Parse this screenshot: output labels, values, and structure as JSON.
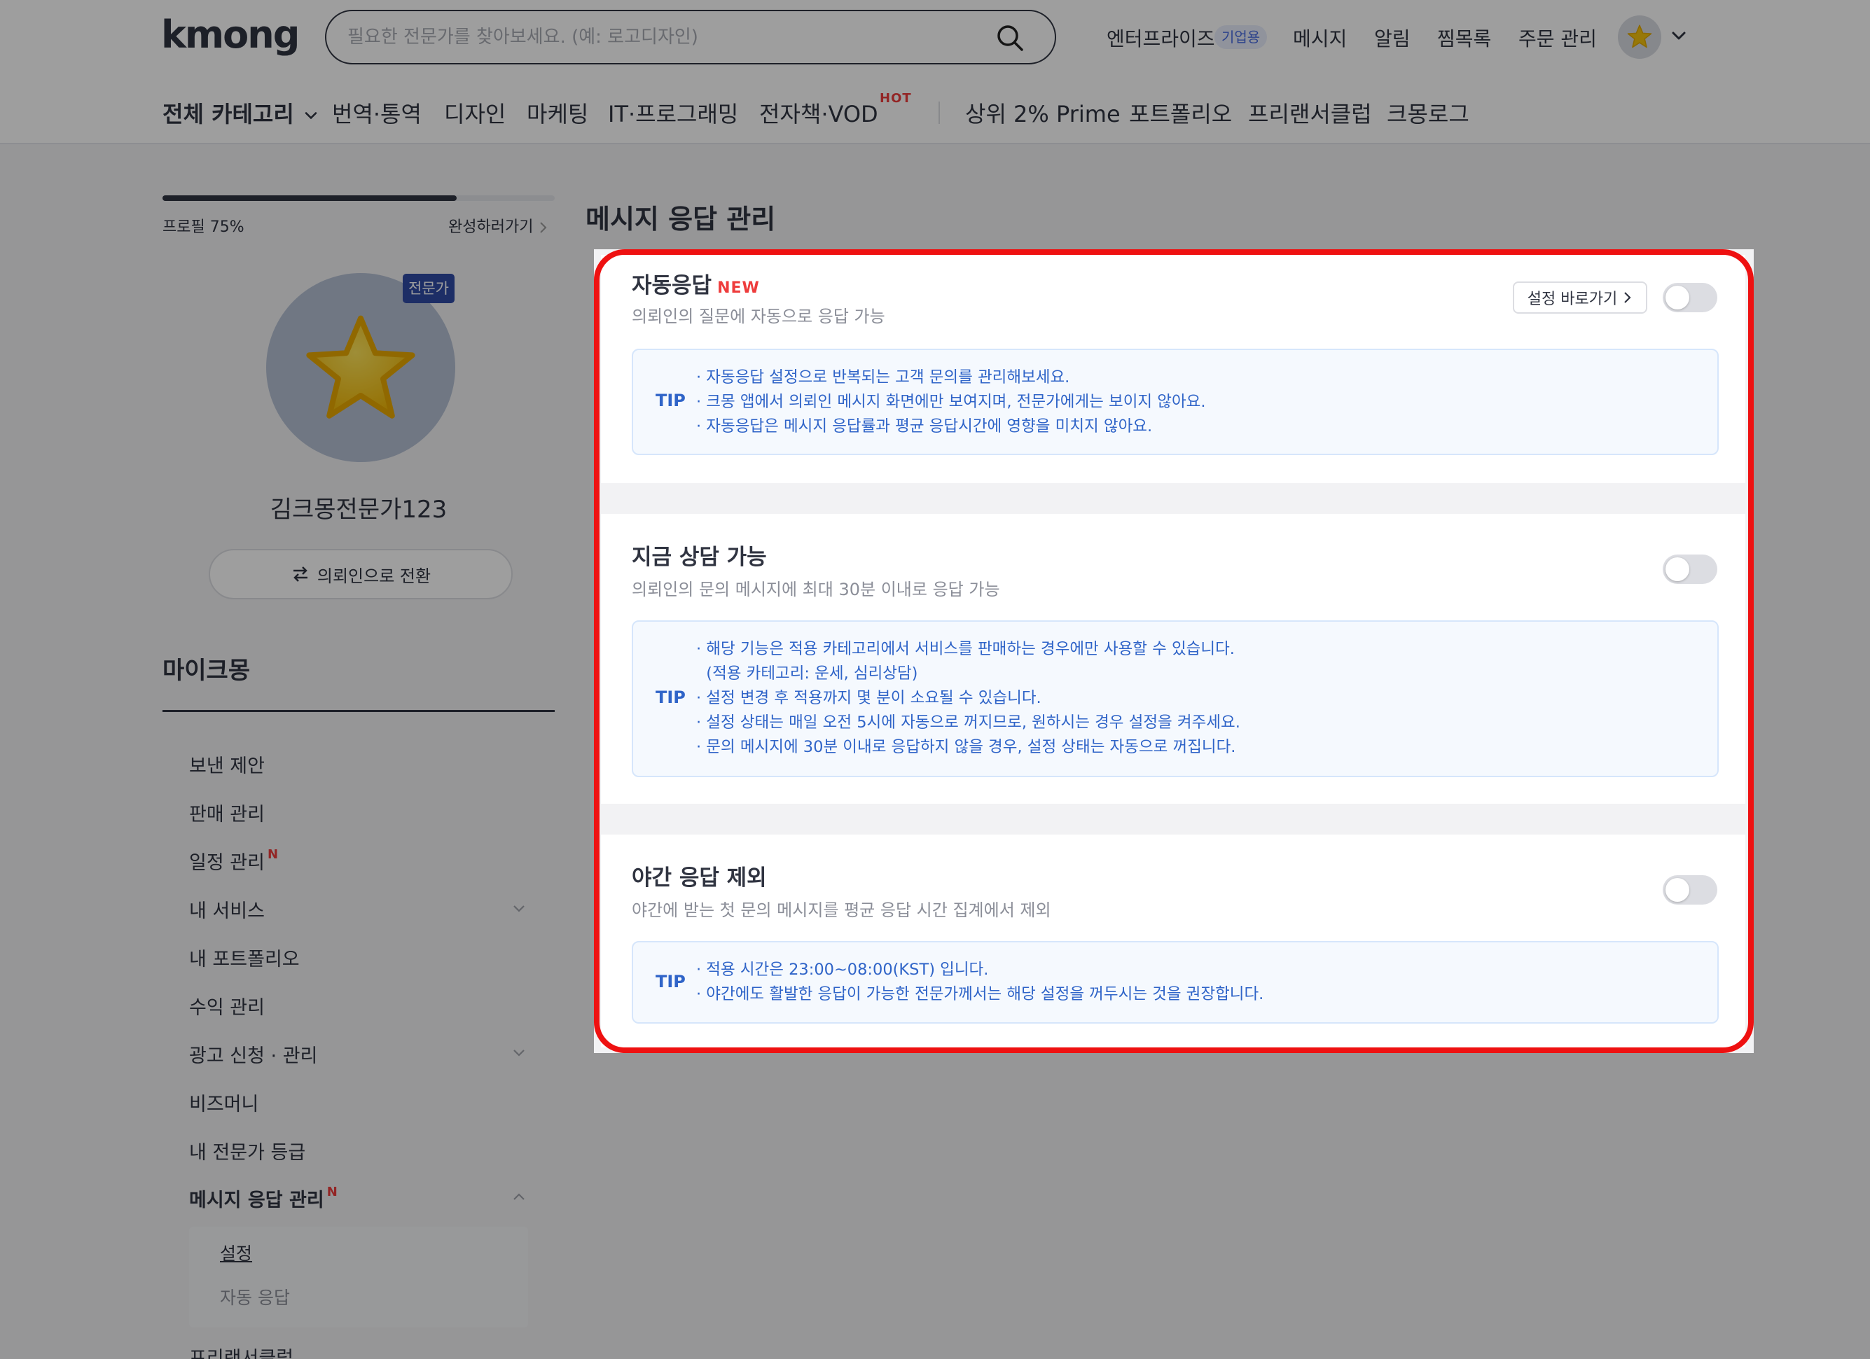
{
  "header": {
    "logo": "kmong",
    "search_placeholder": "필요한 전문가를 찾아보세요. (예: 로고디자인)",
    "menu": {
      "enterprise": "엔터프라이즈",
      "enterprise_badge": "기업용",
      "message": "메시지",
      "alarm": "알림",
      "wishlist": "찜목록",
      "orders": "주문 관리"
    },
    "categories": {
      "all": "전체 카테고리",
      "translation": "번역·통역",
      "design": "디자인",
      "marketing": "마케팅",
      "it": "IT·프로그래밍",
      "ebook": "전자책·VOD",
      "hot": "HOT",
      "prime": "상위 2% Prime",
      "portfolio": "포트폴리오",
      "club": "프리랜서클럽",
      "log": "크몽로그"
    }
  },
  "sidebar": {
    "profile_progress": 0.75,
    "profile_label": "프로필 75%",
    "complete_label": "완성하러가기",
    "expert_badge": "전문가",
    "username": "김크몽전문가123",
    "switch_label": "의뢰인으로 전환",
    "my_title": "마이크몽",
    "items": {
      "sent": "보낸 제안",
      "sales": "판매 관리",
      "schedule": "일정 관리",
      "services": "내 서비스",
      "portfolio": "내 포트폴리오",
      "revenue": "수익 관리",
      "ads": "광고 신청 · 관리",
      "bizmoney": "비즈머니",
      "grade": "내 전문가 등급",
      "msg_mgmt": "메시지 응답 관리",
      "settings": "설정",
      "auto_reply": "자동 응답",
      "club": "프리랜서클럽"
    },
    "n_badge": "N"
  },
  "main": {
    "page_title": "메시지 응답 관리",
    "sections": {
      "auto": {
        "title": "자동응답",
        "badge": "NEW",
        "desc": "의뢰인의 질문에 자동으로 응답 가능",
        "link": "설정 바로가기",
        "tip_label": "TIP",
        "tips": [
          "· 자동응답 설정으로 반복되는 고객 문의를 관리해보세요.",
          "· 크몽 앱에서 의뢰인 메시지 화면에만 보여지며, 전문가에게는 보이지 않아요.",
          "· 자동응답은 메시지 응답률과 평균 응답시간에 영향을 미치지 않아요."
        ],
        "enabled": false
      },
      "now": {
        "title": "지금 상담 가능",
        "desc": "의뢰인의 문의 메시지에 최대 30분 이내로 응답 가능",
        "tip_label": "TIP",
        "tips": [
          "· 해당 기능은 적용 카테고리에서 서비스를 판매하는 경우에만 사용할 수 있습니다.",
          "  (적용 카테고리: 운세, 심리상담)",
          "· 설정 변경 후 적용까지 몇 분이 소요될 수 있습니다.",
          "· 설정 상태는 매일 오전 5시에 자동으로 꺼지므로, 원하시는 경우 설정을 켜주세요.",
          "· 문의 메시지에 30분 이내로 응답하지 않을 경우, 설정 상태는 자동으로 꺼집니다."
        ],
        "enabled": false
      },
      "night": {
        "title": "야간 응답 제외",
        "desc": "야간에 받는 첫 문의 메시지를 평균 응답 시간 집계에서 제외",
        "tip_label": "TIP",
        "tips": [
          "· 적용 시간은 23:00~08:00(KST) 입니다.",
          "· 야간에도 활발한 응답이 가능한 전문가께서는 해당 설정을 꺼두시는 것을 권장합니다."
        ],
        "enabled": false
      }
    }
  },
  "colors": {
    "highlight_frame": "#ee1111",
    "tip_text": "#2f64c8",
    "badge_red": "#ee3c3c",
    "expert_badge": "#2f4ba5"
  }
}
